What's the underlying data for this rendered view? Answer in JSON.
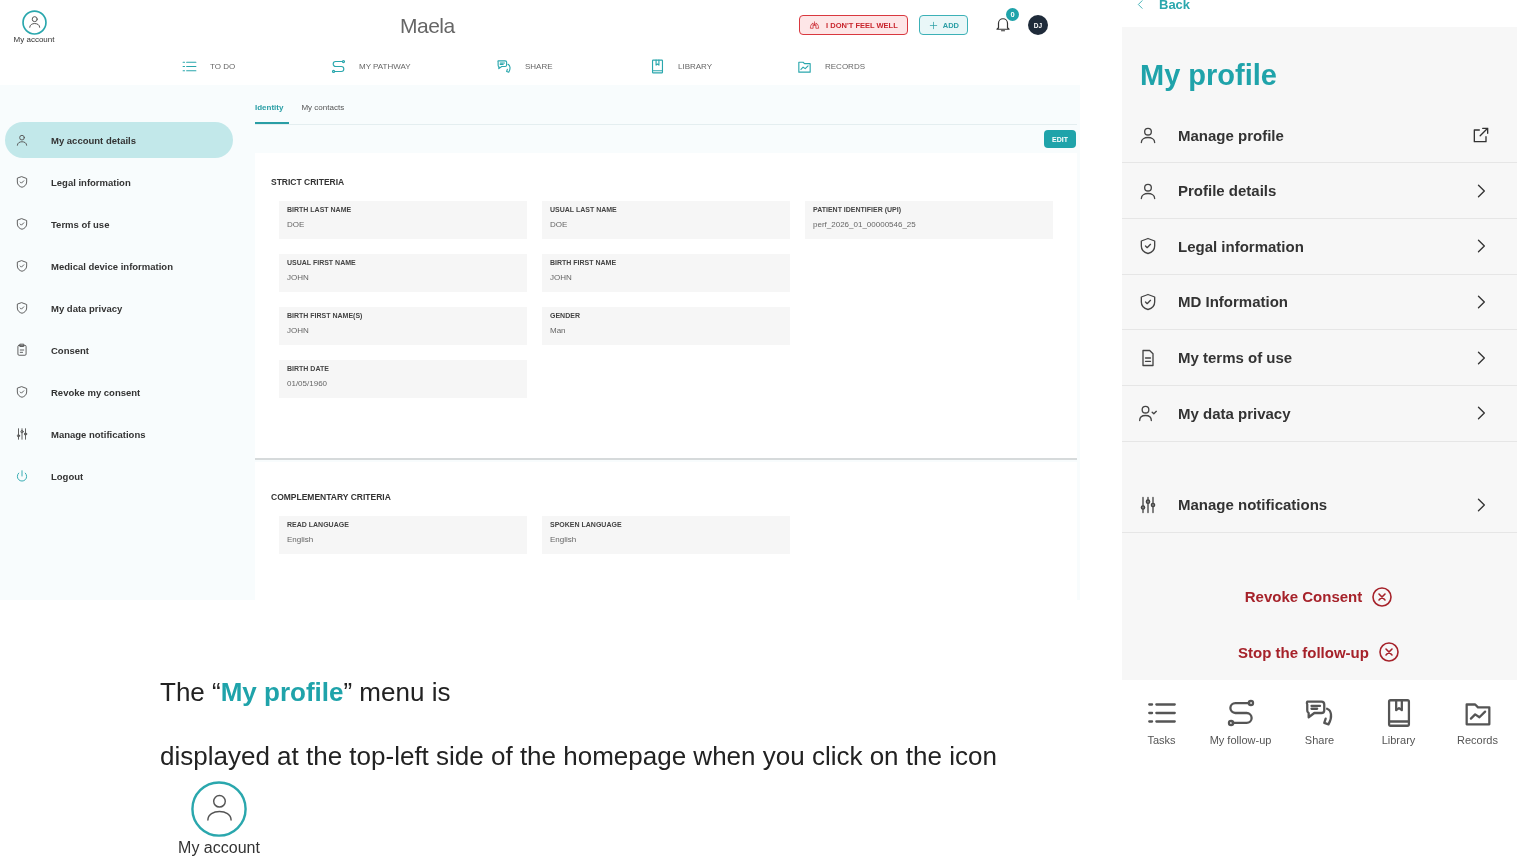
{
  "desktop": {
    "account_label": "My account",
    "logo": "Maela",
    "alert_button": "I DON'T FEEL WELL",
    "add_button": "ADD",
    "notification_count": "0",
    "avatar": "DJ",
    "nav": [
      "TO DO",
      "MY PATHWAY",
      "SHARE",
      "LIBRARY",
      "RECORDS"
    ],
    "sidebar": [
      {
        "label": "My account details",
        "selected": true
      },
      {
        "label": "Legal information",
        "selected": false
      },
      {
        "label": "Terms of use",
        "selected": false
      },
      {
        "label": "Medical device information",
        "selected": false
      },
      {
        "label": "My data privacy",
        "selected": false
      },
      {
        "label": "Consent",
        "selected": false
      },
      {
        "label": "Revoke my consent",
        "selected": false
      },
      {
        "label": "Manage notifications",
        "selected": false
      },
      {
        "label": "Logout",
        "selected": false
      }
    ],
    "tabs": [
      {
        "label": "Identity",
        "selected": true
      },
      {
        "label": "My contacts",
        "selected": false
      }
    ],
    "edit_button": "EDIT",
    "sections": [
      {
        "title": "STRICT CRITERIA",
        "rows": [
          [
            {
              "label": "BIRTH LAST NAME",
              "value": "DOE"
            },
            {
              "label": "USUAL LAST NAME",
              "value": "DOE"
            },
            {
              "label": "PATIENT IDENTIFIER (UPI)",
              "value": "perf_2026_01_00000546_25"
            }
          ],
          [
            {
              "label": "USUAL FIRST NAME",
              "value": "JOHN"
            },
            {
              "label": "BIRTH FIRST NAME",
              "value": "JOHN"
            }
          ],
          [
            {
              "label": "BIRTH FIRST NAME(S)",
              "value": "JOHN"
            },
            {
              "label": "GENDER",
              "value": "Man"
            }
          ],
          [
            {
              "label": "BIRTH DATE",
              "value": "01/05/1960"
            }
          ]
        ]
      },
      {
        "title": "COMPLEMENTARY CRITERIA",
        "rows": [
          [
            {
              "label": "READ LANGUAGE",
              "value": "English"
            },
            {
              "label": "SPOKEN LANGUAGE",
              "value": "English"
            }
          ]
        ]
      }
    ]
  },
  "caption": {
    "line_1": "The “**My profile**” menu is",
    "line_2": "displayed at the top-left side of the homepage when you click on the icon",
    "icon_label": "My account"
  },
  "mobile": {
    "back": "Back",
    "title": "My profile",
    "menu": [
      {
        "label": "Manage profile",
        "kind": "external"
      },
      {
        "label": "Profile details",
        "kind": "chevron"
      },
      {
        "label": "Legal information",
        "kind": "chevron"
      },
      {
        "label": "MD Information",
        "kind": "chevron"
      },
      {
        "label": "My terms of use",
        "kind": "chevron"
      },
      {
        "label": "My data privacy",
        "kind": "chevron"
      }
    ],
    "settings": [
      {
        "label": "Manage notifications",
        "kind": "chevron"
      }
    ],
    "actions": [
      "Revoke Consent",
      "Stop the follow-up"
    ],
    "bottom_nav": [
      "Tasks",
      "My follow-up",
      "Share",
      "Library",
      "Records"
    ]
  }
}
